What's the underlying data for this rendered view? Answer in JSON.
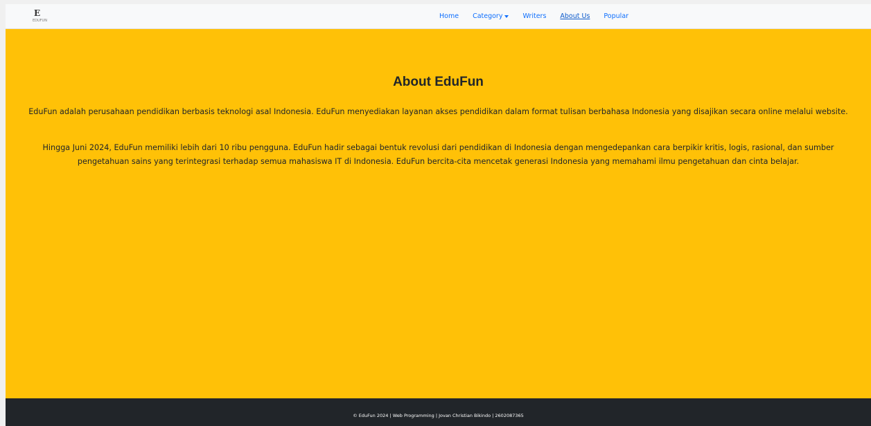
{
  "navbar": {
    "logo_text": "E",
    "logo_sub": "EDUFUN",
    "links": [
      {
        "label": "Home"
      },
      {
        "label": "Category"
      },
      {
        "label": "Writers"
      },
      {
        "label": "About Us"
      },
      {
        "label": "Popular"
      }
    ],
    "active": "About Us"
  },
  "main": {
    "title": "About EduFun",
    "paragraph1": "EduFun adalah perusahaan pendidikan berbasis teknologi asal Indonesia. EduFun menyediakan layanan akses pendidikan dalam format tulisan berbahasa Indonesia yang disajikan secara online melalui website.",
    "paragraph2": "Hingga Juni 2024, EduFun memiliki lebih dari 10 ribu pengguna. EduFun hadir sebagai bentuk revolusi dari pendidikan di Indonesia dengan mengedepankan cara berpikir kritis, logis, rasional, dan sumber pengetahuan sains yang terintegrasi terhadap semua mahasiswa IT di Indonesia. EduFun bercita-cita mencetak generasi Indonesia yang memahami ilmu pengetahuan dan cinta belajar."
  },
  "footer": {
    "text": "© EduFun 2024 | Web Programming | Jovan Christian Bikindo | 2602087365"
  },
  "colors": {
    "background": "#ffc107",
    "navbar": "#f8f9fa",
    "footer": "#212529",
    "link": "#0d6efd"
  }
}
